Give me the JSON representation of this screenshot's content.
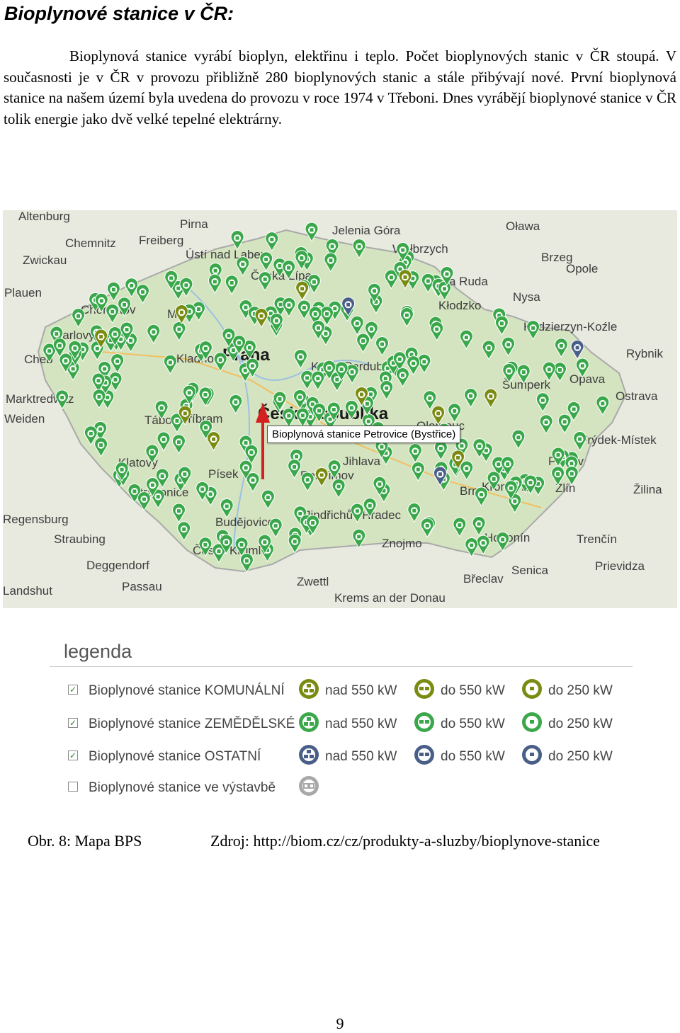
{
  "heading": "Bioplynové stanice v ČR:",
  "paragraph": "Bioplynová stanice vyrábí bioplyn, elektřinu i teplo. Počet bioplynových stanic v ČR stoupá. V současnosti je v ČR v provozu přibližně 280 bioplynových stanic a stále přibývají nové. První bioplynová stanice na našem území byla uvedena do provozu v roce 1974 v Třeboni. Dnes vyrábějí bioplynové stanice v ČR tolik energie jako dvě velké tepelné elektrárny.",
  "map": {
    "tooltip": "Bioplynová stanice Petrovice (Bystřice)",
    "place_labels": [
      "Altenburg",
      "Pirna",
      "Jelenia Góra",
      "Oława",
      "Chemnitz",
      "Freiberg",
      "Ústí nad Labem",
      "Wałbrzych",
      "Brzeg",
      "Opole",
      "Zwickau",
      "Česká Lípa",
      "Nowa Ruda",
      "Plauen",
      "Chomutov",
      "Most",
      "Kłodzko",
      "Nysa",
      "Kędzierzyn-Koźle",
      "Karlovy Vary",
      "Rybnik",
      "Cheb",
      "Praha",
      "Pardubice",
      "Šumperk",
      "Opava",
      "Ostrava",
      "Kladno",
      "Kolín",
      "Marktredwitz",
      "Příbram",
      "Frýdek-Místek",
      "Weiden",
      "Tábor",
      "Jihlava",
      "Olomouc",
      "Přerov",
      "Zlín",
      "Klatovy",
      "Pelhřimov",
      "Brno",
      "Kroměříž",
      "Strakonice",
      "Písek",
      "Jindřichův Hradec",
      "Žilina",
      "Regensburg",
      "Straubing",
      "Budějovice",
      "Znojmo",
      "Hodonín",
      "Trenčín",
      "Deggendorf",
      "Český Krumlov",
      "Senica",
      "Prievidza",
      "Passau",
      "Zwettl",
      "Břeclav",
      "Landshut",
      "Krems an der Donau",
      "Česká republika"
    ],
    "station_counts": {
      "agri_green": 260,
      "municipal_olive": 12,
      "other_blue": 3
    }
  },
  "legend": {
    "title": "legenda",
    "rows": [
      {
        "checked": true,
        "label": "Bioplynové stanice KOMUNÁLNÍ",
        "color": "#7a8b12",
        "sizes": [
          "nad 550 kW",
          "do 550 kW",
          "do 250 kW"
        ]
      },
      {
        "checked": true,
        "label": "Bioplynové stanice ZEMĚDĚLSKÉ",
        "color": "#3aa84a",
        "sizes": [
          "nad 550 kW",
          "do 550 kW",
          "do 250 kW"
        ]
      },
      {
        "checked": true,
        "label": "Bioplynové stanice OSTATNÍ",
        "color": "#4a5f88",
        "sizes": [
          "nad 550 kW",
          "do 550 kW",
          "do 250 kW"
        ]
      },
      {
        "checked": false,
        "label": "Bioplynové stanice ve výstavbě",
        "color": "#a8a8a8",
        "sizes": []
      }
    ]
  },
  "caption_left": "Obr. 8: Mapa BPS",
  "caption_right": "Zdroj: http://biom.cz/cz/produkty-a-sluzby/bioplynove-stanice",
  "page_number": "9"
}
